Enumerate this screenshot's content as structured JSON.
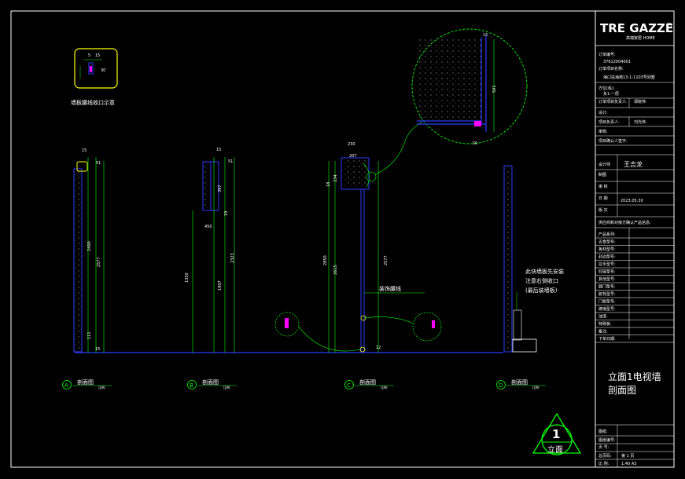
{
  "colors": {
    "background": "#000000",
    "frame": "#ffffff",
    "dim": "#00ff00",
    "wall": "#2a3cff",
    "highlight": "#ffff00",
    "text": "#ffffff",
    "note_text": "#ffffff",
    "title_text": "#ffffff"
  },
  "logo": {
    "text": "TRE GAZZE",
    "sub": "高端家居 HOME"
  },
  "inset": {
    "caption": "墙板腰线收口示意",
    "dims": [
      "5",
      "15"
    ],
    "small_dim": "30"
  },
  "sections": [
    {
      "id": "A",
      "title": "剖面图",
      "scale": "比例:",
      "dims_top": [
        "15",
        "51"
      ],
      "dims_side": [
        "2400",
        "2577",
        "111",
        "15"
      ]
    },
    {
      "id": "B",
      "title": "剖面图",
      "scale": "比例:",
      "dims_top": [
        "15",
        "51"
      ],
      "dims_side": [
        "397",
        "19",
        "450",
        "1350",
        "1907",
        "2323"
      ]
    },
    {
      "id": "C",
      "title": "剖面图",
      "scale": "比例:",
      "dims_top": [
        "230",
        "207"
      ],
      "dims_side": [
        "18",
        "234",
        "2850",
        "2615",
        "2577",
        "12"
      ]
    },
    {
      "id": "D",
      "title": "剖面图",
      "scale": "比例:",
      "dims_top": [],
      "dims_side": []
    }
  ],
  "notes": {
    "waist_line": "装饰腰线",
    "install_note_1": "此块墙板先安装",
    "install_note_2": "注意右侧收口",
    "install_note_3": "(最后装墙板)"
  },
  "detail_dims": [
    "15",
    "501",
    "50"
  ],
  "title_block": {
    "rows": [
      {
        "label": "订单编号:",
        "value": ""
      },
      {
        "label": "",
        "value": "37612004001"
      },
      {
        "label": "订单项目名称:",
        "value": ""
      },
      {
        "label": "",
        "value": "海口扶海苑13-1-1103号别墅"
      },
      {
        "label": "方位(栋):",
        "value": ""
      },
      {
        "label": "",
        "value": "负1-一层"
      },
      {
        "label": "订单项目负责人:",
        "value": "郑晓伟"
      },
      {
        "label": "设计:",
        "value": ""
      },
      {
        "label": "项目负责人:",
        "value": "刘光伟"
      },
      {
        "label": "审核:",
        "value": ""
      },
      {
        "label": "项目确认人签字:",
        "value": ""
      }
    ],
    "designer_label": "设计师",
    "designer_name": "王吉龙",
    "drafter_label": "制图",
    "review_label": "审 核",
    "date_label": "日 期",
    "date_value": "2023.05.30",
    "version_label": "版 次",
    "product_section": "供应商和对接方确认产品信息:",
    "product_rows": [
      "产品系列:",
      "五金型号:",
      "板材型号:",
      "封边型号:",
      "拉手型号:",
      "铰链型号:",
      "其他型号:",
      "趟门型号:",
      "胶背型号:",
      "门板型号:",
      "玻璃型号:",
      "油漆:",
      "特殊板:",
      "备注:",
      "下单日期:"
    ],
    "drawing_title_1": "立面1电视墙",
    "drawing_title_2": "剖面图",
    "bottom_rows": [
      {
        "label": "图纸:",
        "value": ""
      },
      {
        "label": "图纸编号:",
        "value": ""
      },
      {
        "label": "页 号:",
        "value": ""
      },
      {
        "label": "总页码:",
        "value": "第 1 页"
      },
      {
        "label": "比 例:",
        "value": "1:40 A3"
      }
    ]
  },
  "elevation_marker": {
    "number": "1",
    "label": "立面"
  }
}
